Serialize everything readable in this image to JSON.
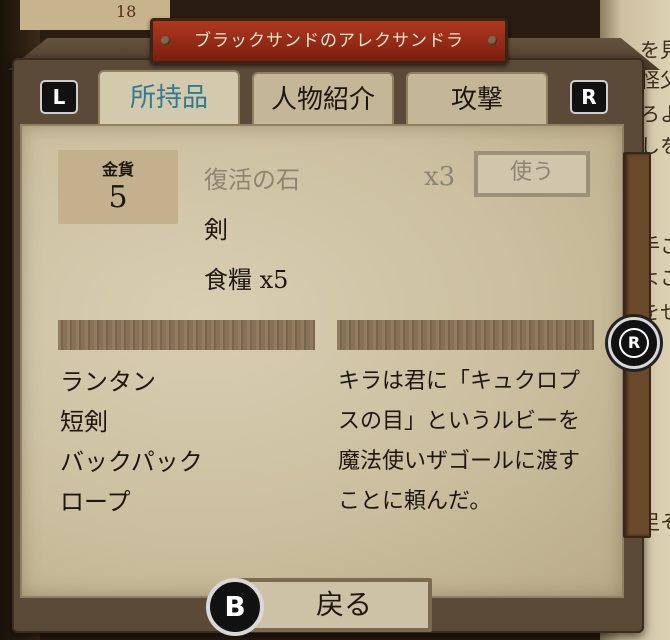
{
  "background": {
    "top_tab_number": "18",
    "page_lines": [
      "を見",
      "怪父",
      "ろよ",
      "しを",
      "手こ",
      "よこ",
      "をせ",
      "足そ"
    ]
  },
  "title": "ブラックサンドのアレクサンドラ",
  "shoulder_buttons": {
    "left": "L",
    "right": "R"
  },
  "tabs": [
    {
      "label": "所持品",
      "active": true
    },
    {
      "label": "人物紹介",
      "active": false
    },
    {
      "label": "攻撃",
      "active": false
    }
  ],
  "gold": {
    "label": "金貨",
    "value": "5"
  },
  "items": [
    {
      "name": "復活の石",
      "enabled": false
    },
    {
      "name": "剣",
      "enabled": true
    },
    {
      "name": "食糧 x5",
      "enabled": true
    }
  ],
  "selected_item": {
    "quantity": "x3",
    "use_label": "使う"
  },
  "equipment_list": [
    "ランタン",
    "短剣",
    "バックパック",
    "ロープ"
  ],
  "description": "キラは君に「キュクロプスの目」というルビーを魔法使いザゴールに渡すことに頼んだ。",
  "right_stick_label": "R",
  "back": {
    "button_glyph": "B",
    "label": "戻る"
  }
}
